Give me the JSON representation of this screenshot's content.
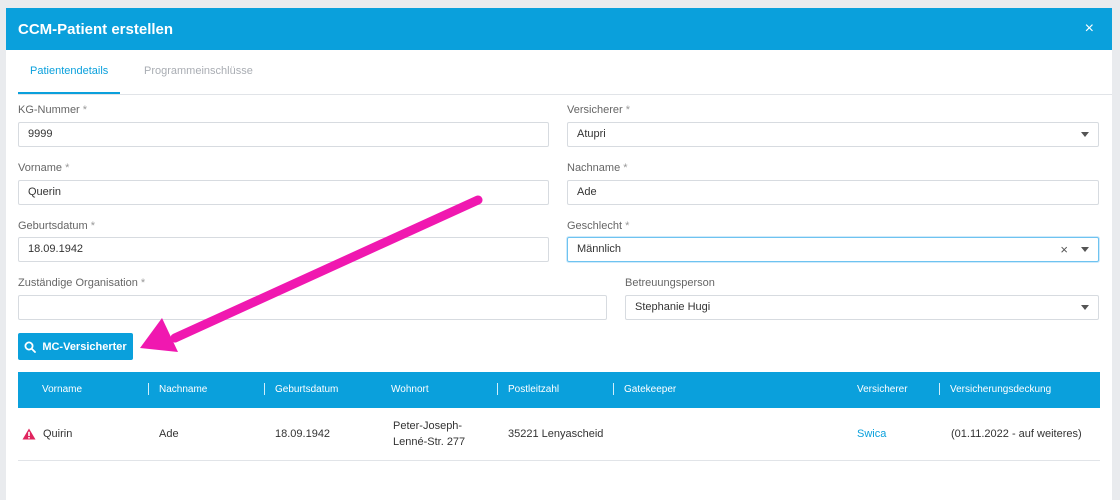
{
  "dialog": {
    "title": "CCM-Patient erstellen",
    "close_glyph": "×"
  },
  "tabs": [
    {
      "label": "Patientendetails"
    },
    {
      "label": "Programmeinschlüsse"
    }
  ],
  "form": {
    "required_mark": "*",
    "kg_nummer": {
      "label": "KG-Nummer",
      "value": "9999"
    },
    "versicherer": {
      "label": "Versicherer",
      "value": "Atupri"
    },
    "vorname": {
      "label": "Vorname",
      "value": "Querin"
    },
    "nachname": {
      "label": "Nachname",
      "value": "Ade"
    },
    "geburtsdatum": {
      "label": "Geburtsdatum",
      "value": "18.09.1942"
    },
    "geschlecht": {
      "label": "Geschlecht",
      "value": "Männlich",
      "clear_glyph": "×"
    },
    "organisation": {
      "label": "Zuständige Organisation",
      "value": ""
    },
    "betreuungsperson": {
      "label": "Betreuungsperson",
      "value": "Stephanie Hugi"
    }
  },
  "search_button": {
    "label": "MC-Versicherter",
    "icon": "search-icon"
  },
  "table": {
    "columns": [
      "Vorname",
      "Nachname",
      "Geburtsdatum",
      "Wohnort",
      "Postleitzahl",
      "Gatekeeper",
      "Versicherer",
      "Versicherungsdeckung"
    ],
    "rows": [
      {
        "vorname": "Quirin",
        "nachname": "Ade",
        "geburtsdatum": "18.09.1942",
        "wohnort_line1": "Peter-Joseph-",
        "wohnort_line2": "Lenné-Str. 277",
        "postleitzahl": "35221 Lenyascheid",
        "gatekeeper": "",
        "versicherer": "Swica",
        "versicherungsdeckung": "(01.11.2022 - auf weiteres)",
        "status_icon": "warning-icon"
      }
    ]
  },
  "colors": {
    "primary": "#0aa0dc",
    "warning": "#e0245e",
    "annotation_arrow": "#f018b0"
  }
}
